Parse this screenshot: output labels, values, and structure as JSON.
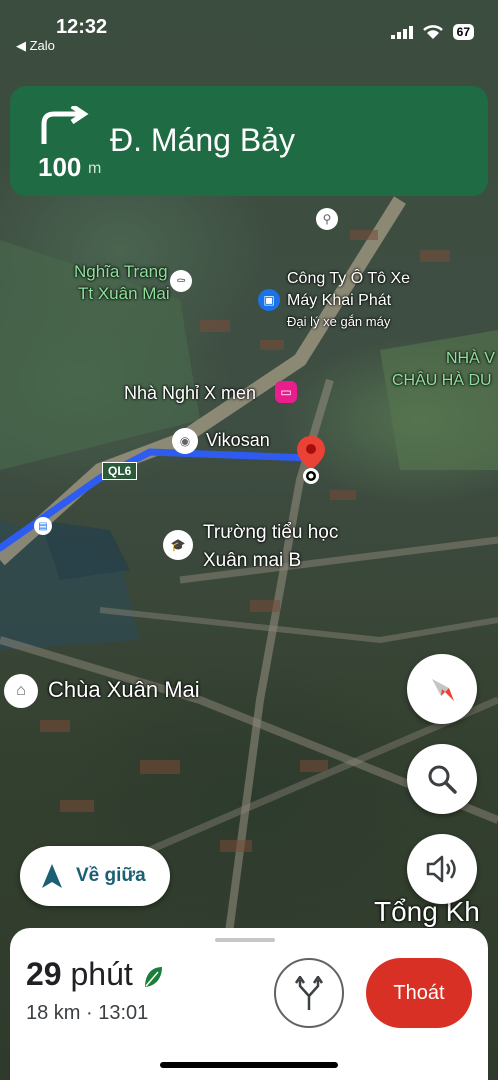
{
  "status_bar": {
    "time": "12:32",
    "back_app": "◀ Zalo",
    "battery": "67"
  },
  "banner": {
    "distance_value": "100",
    "distance_unit": "m",
    "street": "Đ. Máng Bảy",
    "maneuver": "turn-right-icon"
  },
  "map_labels": {
    "cemetery_line1": "Nghĩa Trang",
    "cemetery_line2": "Tt Xuân Mai",
    "company_line1": "Công Ty Ô Tô Xe",
    "company_line2": "Máy Khai Phát",
    "company_sub": "Đại lý xe gắn máy",
    "right_label_line1": "NHÀ V",
    "right_label_line2": "CHÂU HÀ DU",
    "motel": "Nhà Nghỉ X men",
    "vikosan": "Vikosan",
    "road_badge": "QL6",
    "school_line1": "Trường tiểu học",
    "school_line2": "Xuân mai B",
    "pagoda": "Chùa Xuân Mai",
    "bottom_right": "Tổng Kh"
  },
  "buttons": {
    "recenter": "Về giữa",
    "exit": "Thoát"
  },
  "trip": {
    "duration_num": "29",
    "duration_unit": "phút",
    "details": "18 km · 13:01"
  },
  "colors": {
    "banner": "#1f6b43",
    "route": "#2f5cf0",
    "exit": "#d93025",
    "pin": "#ea4335"
  }
}
